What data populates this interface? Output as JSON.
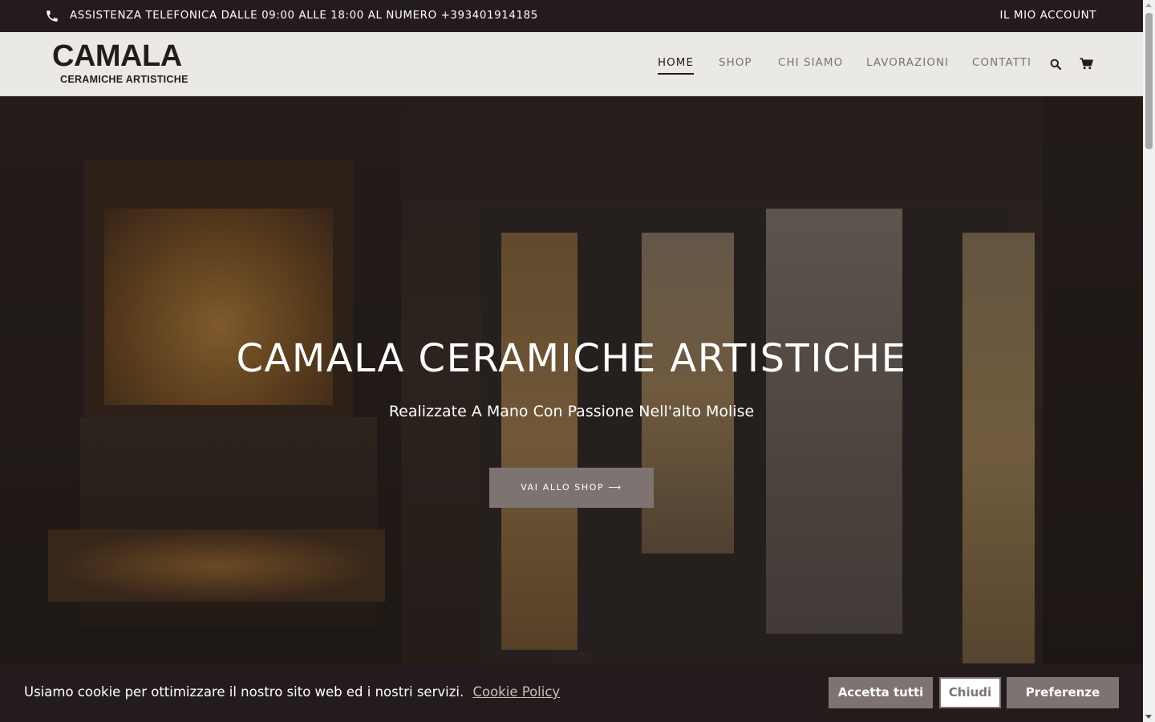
{
  "topbar": {
    "assist_text": "ASSISTENZA TELEFONICA DALLE 09:00 ALLE 18:00 AL NUMERO +393401914185",
    "account_label": "IL MIO ACCOUNT"
  },
  "logo": {
    "title": "CAMALA",
    "subtitle": "CERAMICHE ARTISTICHE"
  },
  "nav": {
    "items": [
      {
        "label": "HOME",
        "active": true
      },
      {
        "label": "SHOP",
        "active": false
      },
      {
        "label": "CHI SIAMO",
        "active": false
      },
      {
        "label": "LAVORAZIONI",
        "active": false
      },
      {
        "label": "CONTATTI",
        "active": false
      }
    ]
  },
  "hero": {
    "title": "CAMALA CERAMICHE ARTISTICHE",
    "subtitle": "Realizzate A Mano Con Passione Nell'alto Molise",
    "button_label": "VAI ALLO SHOP ⟶"
  },
  "cookie": {
    "message": "Usiamo cookie per ottimizzare il nostro sito web ed i nostri servizi.",
    "policy_link": "Cookie Policy",
    "accept_label": "Accetta tutti",
    "close_label": "Chiudi",
    "prefs_label": "Preferenze"
  },
  "colors": {
    "dark": "#241c1c",
    "accent": "#7d7471",
    "header_bg": "#ebe9e6"
  }
}
